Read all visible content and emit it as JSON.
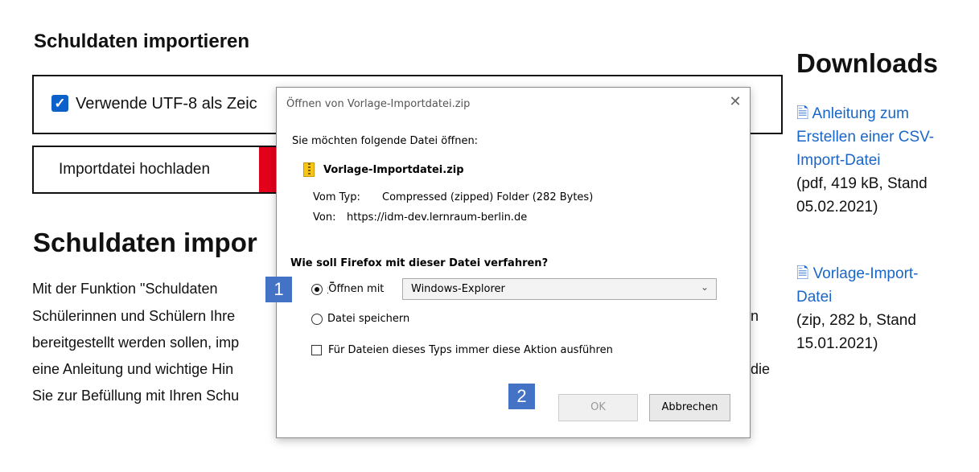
{
  "page": {
    "title_import": "Schuldaten importieren",
    "utf8_label": "Verwende UTF-8 als Zeic",
    "upload_label": "Importdatei hochladen",
    "title_import2": "Schuldaten impor",
    "paragraph_lines": [
      "Mit der Funktion \"Schuldaten",
      "Schülerinnen und Schülern Ihre",
      "bereitgestellt werden sollen, imp",
      "eine Anleitung und wichtige Hin",
      "Sie zur Befüllung mit Ihren Schu"
    ],
    "paragraph_right_fragments": {
      "line2": "n",
      "line4": "die"
    }
  },
  "downloads": {
    "title": "Downloads",
    "items": [
      {
        "link_lines": [
          "Anleitung zum",
          "Erstellen einer CSV-",
          "Import-Datei"
        ],
        "meta_lines": [
          "(pdf, 419 kB, Stand",
          "05.02.2021)"
        ]
      },
      {
        "link_lines": [
          "Vorlage-Import-",
          "Datei"
        ],
        "meta_lines": [
          "(zip, 282 b, Stand",
          "15.01.2021)"
        ]
      }
    ]
  },
  "dialog": {
    "title": "Öffnen von Vorlage-Importdatei.zip",
    "intro": "Sie möchten folgende Datei öffnen:",
    "filename": "Vorlage-Importdatei.zip",
    "type_label": "Vom Typ:",
    "type_value": "Compressed (zipped) Folder (282 Bytes)",
    "from_label": "Von:",
    "from_value": "https://idm-dev.lernraum-berlin.de",
    "question": "Wie soll Firefox mit dieser Datei verfahren?",
    "open_with_label": "Öffnen mit",
    "open_with_value": "Windows-Explorer",
    "save_label": "Datei speichern",
    "always_label": "Für Dateien dieses Typs immer diese Aktion ausführen",
    "ok_label": "OK",
    "cancel_label": "Abbrechen"
  },
  "annotations": {
    "badge1": "1",
    "badge2": "2"
  },
  "colors": {
    "link": "#1a66c8",
    "checkbox": "#0b61c9",
    "badge": "#4472c4",
    "upload_accent": "#e3001b"
  },
  "icons": {
    "utf_checkbox": "checkbox-checked-icon",
    "doc": "document-icon",
    "zip": "zip-folder-icon",
    "close": "close-icon",
    "dropdown": "chevron-down-icon"
  }
}
